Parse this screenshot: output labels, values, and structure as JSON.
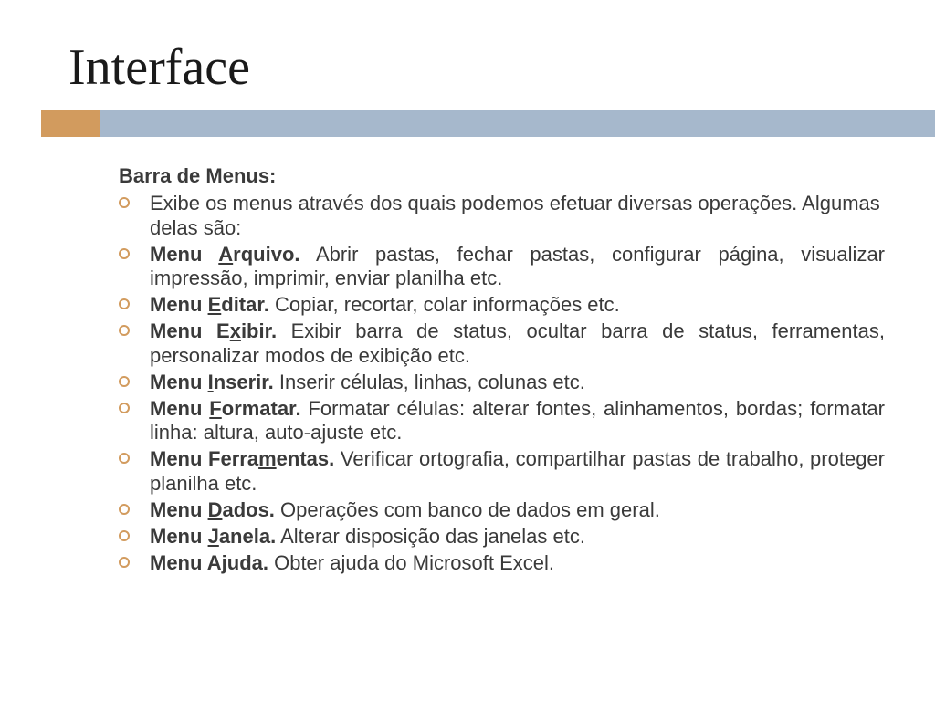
{
  "title": "Interface",
  "section_heading": "Barra de Menus:",
  "items": {
    "0": {
      "text": "Exibe os menus através dos quais podemos efetuar diversas operações. Algumas delas são:"
    },
    "1": {
      "prefix": "Menu ",
      "accel": "A",
      "rest_label": "rquivo.",
      "desc": " Abrir pastas, fechar pastas, configurar página, visualizar impressão, imprimir, enviar planilha etc."
    },
    "2": {
      "prefix": "Menu ",
      "accel": "E",
      "rest_label": "ditar.",
      "desc": " Copiar, recortar, colar informações etc."
    },
    "3": {
      "prefix": "Menu E",
      "accel": "x",
      "rest_label": "ibir.",
      "desc": " Exibir barra de status, ocultar barra de status, ferramentas, personalizar modos de exibição etc."
    },
    "4": {
      "prefix": "Menu ",
      "accel": "I",
      "rest_label": "nserir.",
      "desc": " Inserir células, linhas, colunas etc."
    },
    "5": {
      "prefix": "Menu ",
      "accel": "F",
      "rest_label": "ormatar.",
      "desc": " Formatar células: alterar fontes, alinhamentos, bordas; formatar linha: altura, auto-ajuste etc."
    },
    "6": {
      "prefix": "Menu Ferra",
      "accel": "m",
      "rest_label": "entas.",
      "desc": " Verificar ortografia, compartilhar pastas de trabalho, proteger planilha etc."
    },
    "7": {
      "prefix": "Menu ",
      "accel": "D",
      "rest_label": "ados.",
      "desc": " Operações com banco de dados em geral."
    },
    "8": {
      "prefix": "Menu ",
      "accel": "J",
      "rest_label": "anela.",
      "desc": " Alterar disposição das janelas etc."
    },
    "9": {
      "prefix": "Menu A",
      "accel": "j",
      "rest_label": "uda.",
      "desc": " Obter ajuda do Microsoft Excel."
    }
  }
}
